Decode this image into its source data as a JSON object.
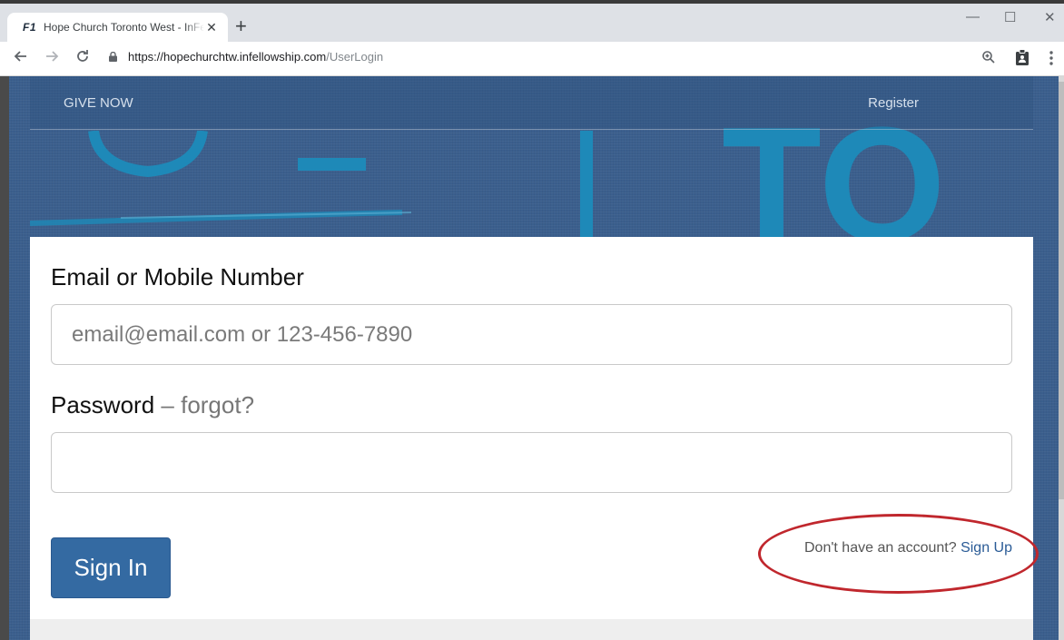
{
  "browser": {
    "tab_favicon": "F1",
    "tab_title": "Hope Church Toronto West - InFellowship",
    "tab_close": "✕",
    "new_tab": "+",
    "url_host": "https://hopechurchtw.infellowship.com",
    "url_path": "/UserLogin",
    "window_controls": {
      "minimize": "—",
      "maximize": "☐",
      "close": "✕"
    },
    "icons": [
      "back-icon",
      "forward-icon",
      "reload-icon",
      "lock-icon",
      "zoom-icon",
      "clipboard-extension-icon",
      "menu-dots-icon"
    ]
  },
  "nav": {
    "give_now": "GIVE NOW",
    "register": "Register"
  },
  "decor": {
    "letters": "TO"
  },
  "form": {
    "email_label": "Email or Mobile Number",
    "email_placeholder": "email@email.com or 123-456-7890",
    "email_value": "",
    "password_label": "Password",
    "password_dash": "–",
    "forgot": "forgot?",
    "password_value": "",
    "sign_in": "Sign In",
    "no_account": "Don't have an account?",
    "sign_up": "Sign Up"
  },
  "colors": {
    "page_blue": "#3b5f8d",
    "accent_teal": "#1e89b8",
    "button_blue": "#346aa2",
    "annotation_red": "#c0272d"
  }
}
